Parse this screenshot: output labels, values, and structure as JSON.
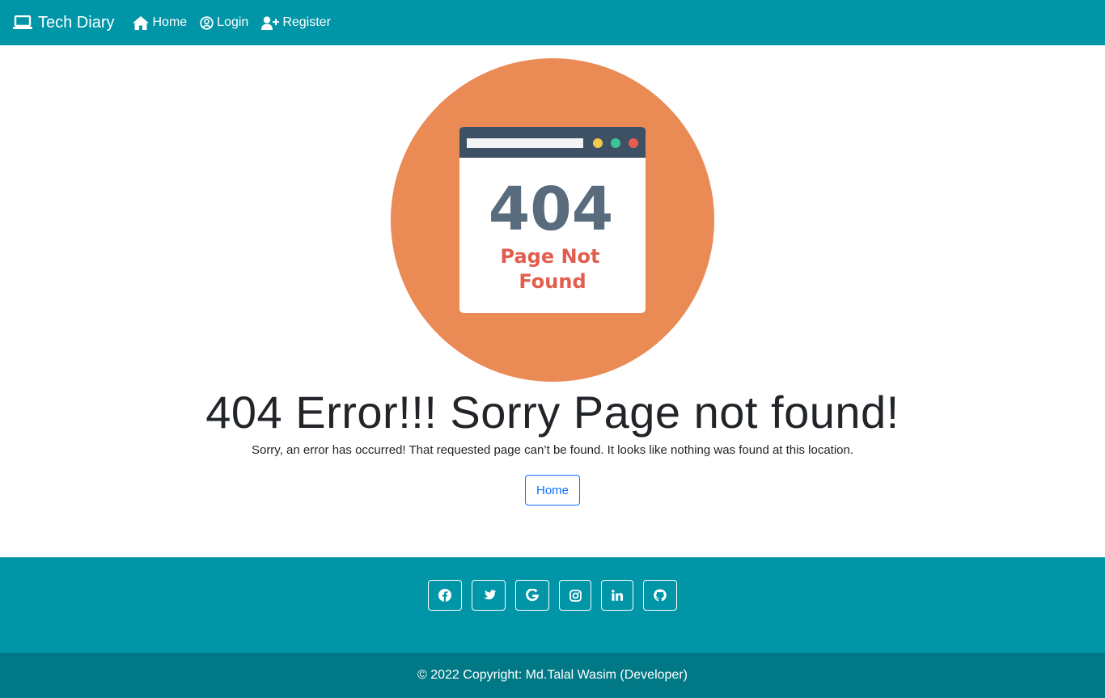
{
  "navbar": {
    "brand": "Tech Diary",
    "links": [
      {
        "label": "Home",
        "icon": "home-icon"
      },
      {
        "label": "Login",
        "icon": "user-circle-icon"
      },
      {
        "label": "Register",
        "icon": "user-plus-icon"
      }
    ],
    "color": "#0096a7"
  },
  "illustration": {
    "code": "404",
    "caption_line1": "Page Not",
    "caption_line2": "Found",
    "circle_color": "#ea8a55"
  },
  "main": {
    "heading": "404 Error!!! Sorry Page not found!",
    "message": "Sorry, an error has occurred! That requested page can’t be found. It looks like nothing was found at this location.",
    "home_button": "Home"
  },
  "footer": {
    "social": [
      "facebook-icon",
      "twitter-icon",
      "google-icon",
      "instagram-icon",
      "linkedin-icon",
      "github-icon"
    ],
    "copyright": "© 2022 Copyright: Md.Talal Wasim (Developer)",
    "social_bg": "#0096a7",
    "copyright_bg": "#007885"
  }
}
